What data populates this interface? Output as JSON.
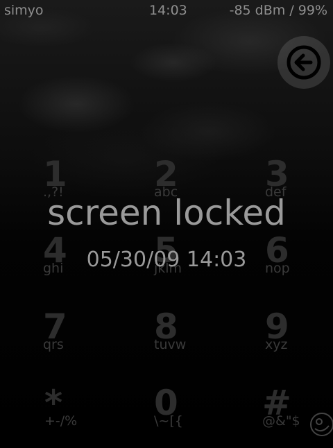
{
  "status_bar": {
    "carrier": "simyo",
    "clock": "14:03",
    "signal": "-85 dBm / 99%"
  },
  "back_button": {
    "icon": "back-arrow-icon"
  },
  "keypad": [
    {
      "digit": "1",
      "letters": ".,?!"
    },
    {
      "digit": "2",
      "letters": "abc"
    },
    {
      "digit": "3",
      "letters": "def"
    },
    {
      "digit": "4",
      "letters": "ghi"
    },
    {
      "digit": "5",
      "letters": "jklm"
    },
    {
      "digit": "6",
      "letters": "nop"
    },
    {
      "digit": "7",
      "letters": "qrs"
    },
    {
      "digit": "8",
      "letters": "tuvw"
    },
    {
      "digit": "9",
      "letters": "xyz"
    },
    {
      "digit": "*",
      "letters": "+-/%"
    },
    {
      "digit": "0",
      "letters": "\\~[{"
    },
    {
      "digit": "#",
      "letters": "@&\"$"
    }
  ],
  "lock": {
    "title": "screen locked",
    "datetime": "05/30/09 14:03"
  },
  "logo": {
    "icon": "openmoko-logo-icon"
  }
}
